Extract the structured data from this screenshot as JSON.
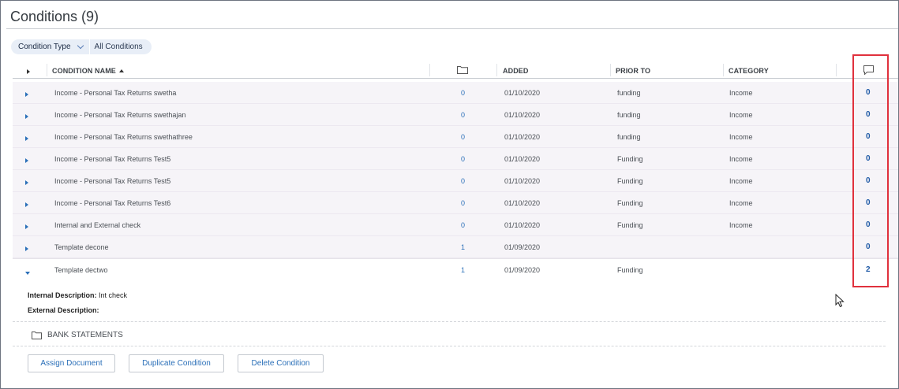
{
  "page": {
    "title": "Conditions (9)"
  },
  "filter": {
    "type_label": "Condition Type",
    "value_label": "All Conditions"
  },
  "table": {
    "headers": {
      "name": "CONDITION NAME",
      "added": "ADDED",
      "prior_to": "PRIOR TO",
      "category": "CATEGORY"
    },
    "rows": [
      {
        "name": "Income - Personal Tax Returns swetha",
        "docs": "0",
        "added": "01/10/2020",
        "prior_to": "funding",
        "category": "Income",
        "comments": "0"
      },
      {
        "name": "Income - Personal Tax Returns swethajan",
        "docs": "0",
        "added": "01/10/2020",
        "prior_to": "funding",
        "category": "Income",
        "comments": "0"
      },
      {
        "name": "Income - Personal Tax Returns swethathree",
        "docs": "0",
        "added": "01/10/2020",
        "prior_to": "funding",
        "category": "Income",
        "comments": "0"
      },
      {
        "name": "Income - Personal Tax Returns Test5",
        "docs": "0",
        "added": "01/10/2020",
        "prior_to": "Funding",
        "category": "Income",
        "comments": "0"
      },
      {
        "name": "Income - Personal Tax Returns Test5",
        "docs": "0",
        "added": "01/10/2020",
        "prior_to": "Funding",
        "category": "Income",
        "comments": "0"
      },
      {
        "name": "Income - Personal Tax Returns Test6",
        "docs": "0",
        "added": "01/10/2020",
        "prior_to": "Funding",
        "category": "Income",
        "comments": "0"
      },
      {
        "name": "Internal and External check",
        "docs": "0",
        "added": "01/10/2020",
        "prior_to": "Funding",
        "category": "Income",
        "comments": "0"
      },
      {
        "name": "Template decone",
        "docs": "1",
        "added": "01/09/2020",
        "prior_to": "",
        "category": "",
        "comments": "0"
      },
      {
        "name": "Template dectwo",
        "docs": "1",
        "added": "01/09/2020",
        "prior_to": "Funding",
        "category": "",
        "comments": "2"
      }
    ]
  },
  "detail": {
    "internal_label": "Internal Description:",
    "internal_value": "Int check",
    "external_label": "External Description:",
    "external_value": "",
    "folder_label": "BANK STATEMENTS"
  },
  "actions": {
    "assign": "Assign Document",
    "duplicate": "Duplicate Condition",
    "delete": "Delete Condition"
  },
  "colors": {
    "accent": "#2a6fb8",
    "highlight": "#e0313d",
    "row_shade": "#f6f4f8"
  },
  "icons": {
    "folder": "folder-icon",
    "comment": "comment-icon",
    "expand": "expand-arrow-icon",
    "sort": "sort-ascending-icon"
  }
}
